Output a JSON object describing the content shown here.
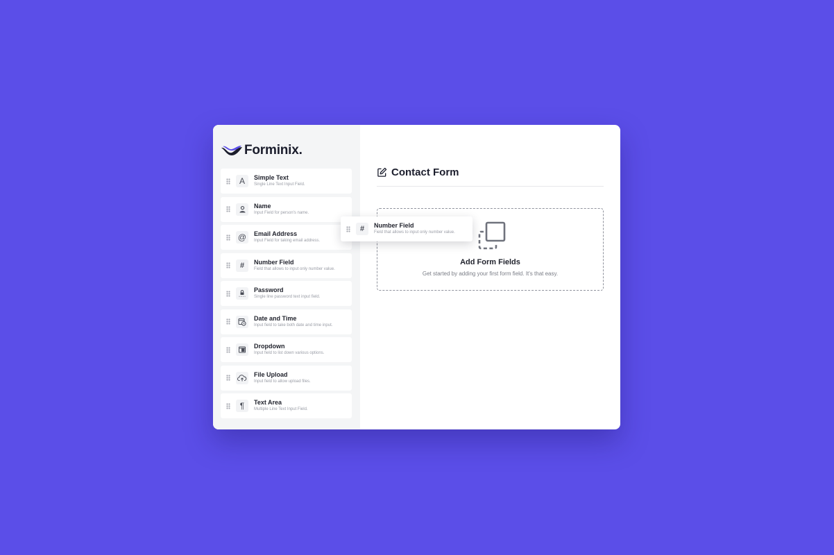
{
  "brand": {
    "name": "Forminix.",
    "accent": "#5b4ee8"
  },
  "sidebar": {
    "items": [
      {
        "title": "Simple Text",
        "desc": "Single Line Text Input Field.",
        "icon": "letter-a-icon"
      },
      {
        "title": "Name",
        "desc": "Input Field for person's name.",
        "icon": "person-icon"
      },
      {
        "title": "Email Address",
        "desc": "Input Field for taking email address.",
        "icon": "at-icon"
      },
      {
        "title": "Number Field",
        "desc": "Field that allows to input only number value.",
        "icon": "hash-icon"
      },
      {
        "title": "Password",
        "desc": "Single line password  text input field.",
        "icon": "lock-icon"
      },
      {
        "title": "Date and Time",
        "desc": "Input field to take both date and time input.",
        "icon": "calendar-clock-icon"
      },
      {
        "title": "Dropdown",
        "desc": "Input field to list down various options.",
        "icon": "dropdown-icon"
      },
      {
        "title": "File Upload",
        "desc": "Input field to allow upload files.",
        "icon": "cloud-upload-icon"
      },
      {
        "title": "Text Area",
        "desc": "Multiple Line Text Input Field.",
        "icon": "pilcrow-icon"
      }
    ]
  },
  "main": {
    "form_title": "Contact Form",
    "dropzone": {
      "title": "Add Form Fields",
      "subtitle": "Get started by adding your first form field. It's that easy."
    }
  },
  "dragging": {
    "title": "Number Field",
    "desc": "Field that allows to input only number value.",
    "icon": "hash-icon"
  },
  "glyphs": {
    "letter_a": "A",
    "at": "@",
    "hash": "#",
    "pilcrow": "¶"
  }
}
